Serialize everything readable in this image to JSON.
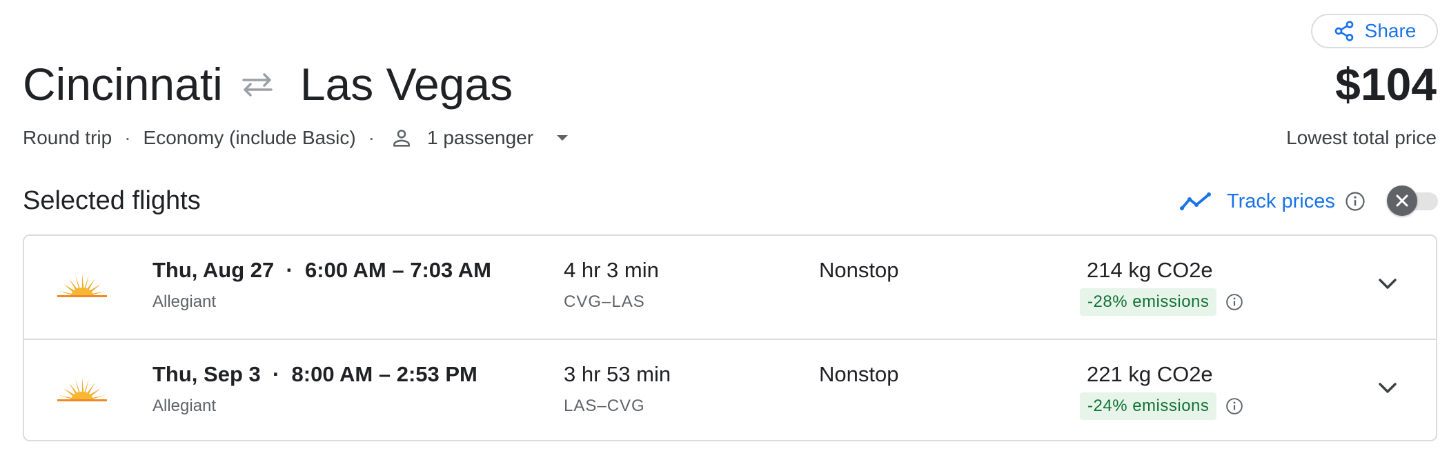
{
  "share": {
    "label": "Share",
    "icon": "share-icon"
  },
  "route": {
    "origin": "Cincinnati",
    "destination": "Las Vegas",
    "arrow_icon": "swap-arrows-icon"
  },
  "price": {
    "value": "$104",
    "label": "Lowest total price"
  },
  "trip": {
    "type": "Round trip",
    "cabin": "Economy (include Basic)",
    "passengers": "1 passenger",
    "passenger_icon": "person-icon"
  },
  "section": {
    "title": "Selected flights"
  },
  "track_prices": {
    "label": "Track prices",
    "enabled": false
  },
  "colors": {
    "accent": "#1a73e8",
    "text": "#202124",
    "muted": "#5f6368",
    "emissions_bg": "#e6f4ea",
    "emissions_text": "#137333",
    "border": "#dadce0"
  },
  "flights": [
    {
      "date": "Thu, Aug 27",
      "time_range": "6:00 AM – 7:03 AM",
      "airline": "Allegiant",
      "duration": "4 hr 3 min",
      "airports": "CVG–LAS",
      "stops": "Nonstop",
      "co2": "214 kg CO2e",
      "emissions": "-28% emissions"
    },
    {
      "date": "Thu, Sep 3",
      "time_range": "8:00 AM – 2:53 PM",
      "airline": "Allegiant",
      "duration": "3 hr 53 min",
      "airports": "LAS–CVG",
      "stops": "Nonstop",
      "co2": "221 kg CO2e",
      "emissions": "-24% emissions"
    }
  ]
}
